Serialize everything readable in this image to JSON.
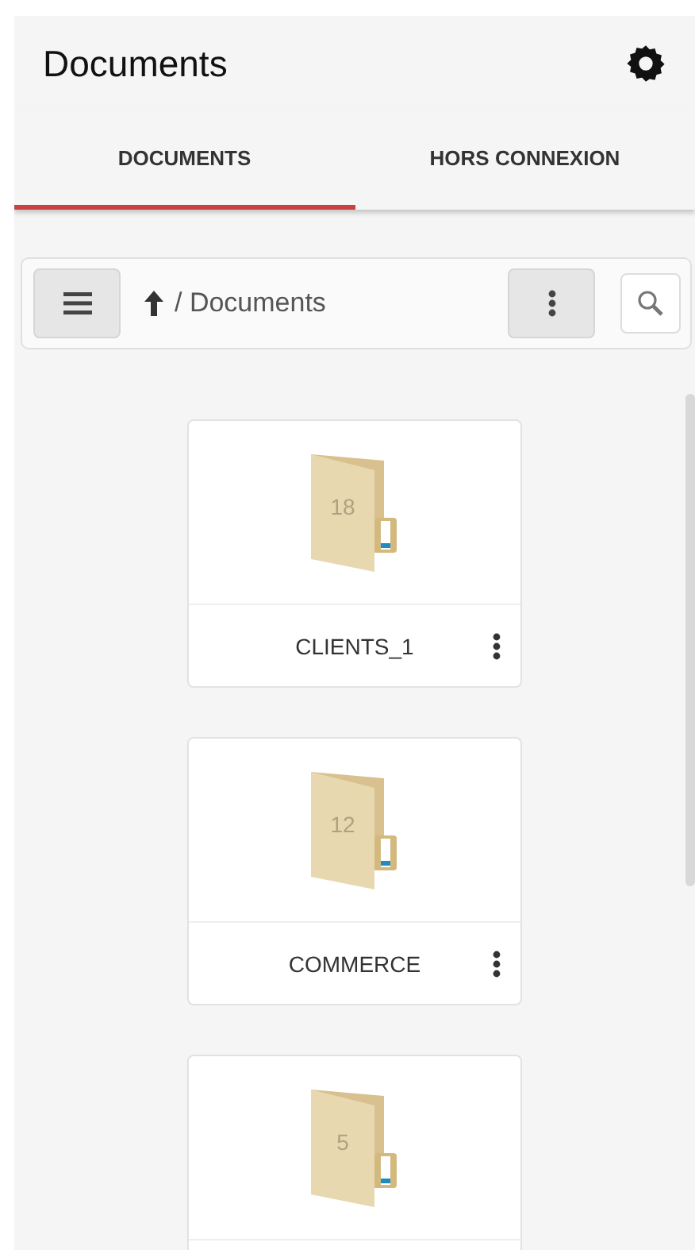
{
  "header": {
    "title": "Documents"
  },
  "tabs": [
    {
      "label": "DOCUMENTS",
      "selected": true
    },
    {
      "label": "HORS CONNEXION",
      "selected": false
    }
  ],
  "toolbar": {
    "path": "/ Documents"
  },
  "folders": [
    {
      "count": "18",
      "name": "CLIENTS_1"
    },
    {
      "count": "12",
      "name": "COMMERCE"
    },
    {
      "count": "5"
    }
  ]
}
